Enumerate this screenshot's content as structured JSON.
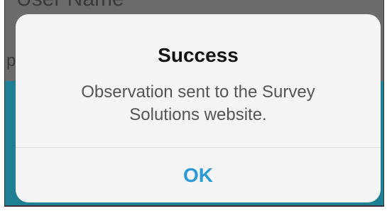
{
  "background": {
    "field_label": "User Name",
    "edge_char": "p"
  },
  "alert": {
    "title": "Success",
    "message": "Observation sent to the Survey Solutions website.",
    "ok_label": "OK"
  },
  "colors": {
    "accent": "#2c9ad6",
    "background_teal": "#1f7f95",
    "dialog_bg": "#f4f4f4"
  }
}
